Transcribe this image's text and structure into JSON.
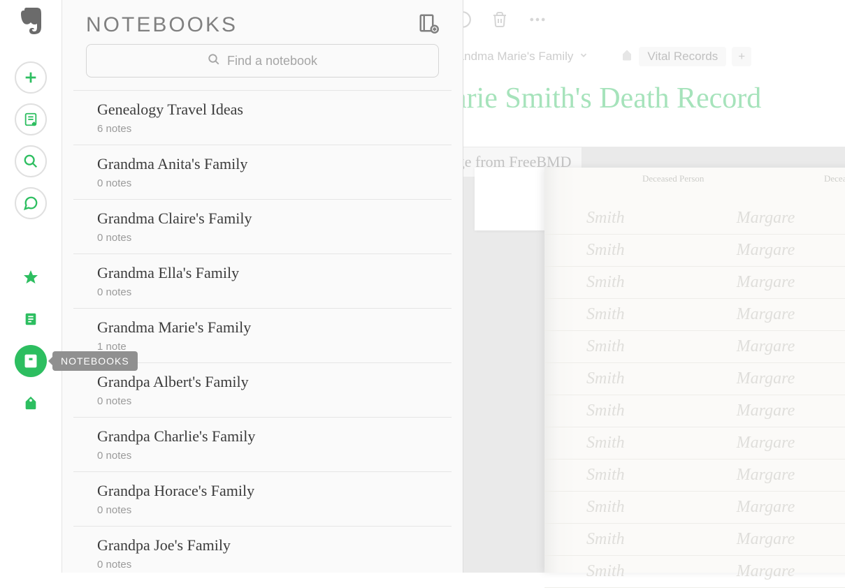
{
  "rail": {
    "tooltip": "NOTEBOOKS"
  },
  "panel": {
    "title": "NOTEBOOKS",
    "search_placeholder": "Find a notebook"
  },
  "notebooks": [
    {
      "name": "Genealogy Travel Ideas",
      "count": "6 notes"
    },
    {
      "name": "Grandma Anita's Family",
      "count": "0 notes"
    },
    {
      "name": "Grandma Claire's Family",
      "count": "0 notes"
    },
    {
      "name": "Grandma Ella's Family",
      "count": "0 notes"
    },
    {
      "name": "Grandma Marie's Family",
      "count": "1 note"
    },
    {
      "name": "Grandpa Albert's Family",
      "count": "0 notes"
    },
    {
      "name": "Grandpa Charlie's Family",
      "count": "0 notes"
    },
    {
      "name": "Grandpa Horace's Family",
      "count": "0 notes"
    },
    {
      "name": "Grandpa Joe's Family",
      "count": "0 notes"
    }
  ],
  "note": {
    "notebook": "randma Marie's Family",
    "tag": "Vital Records",
    "add_tag": "+",
    "title": "arie Smith's Death Record",
    "caption": "age from FreeBMD",
    "column_header_1": "Deceased Person",
    "column_header_2": "Decea",
    "cursive1": "Smith",
    "cursive2": "Margare"
  }
}
